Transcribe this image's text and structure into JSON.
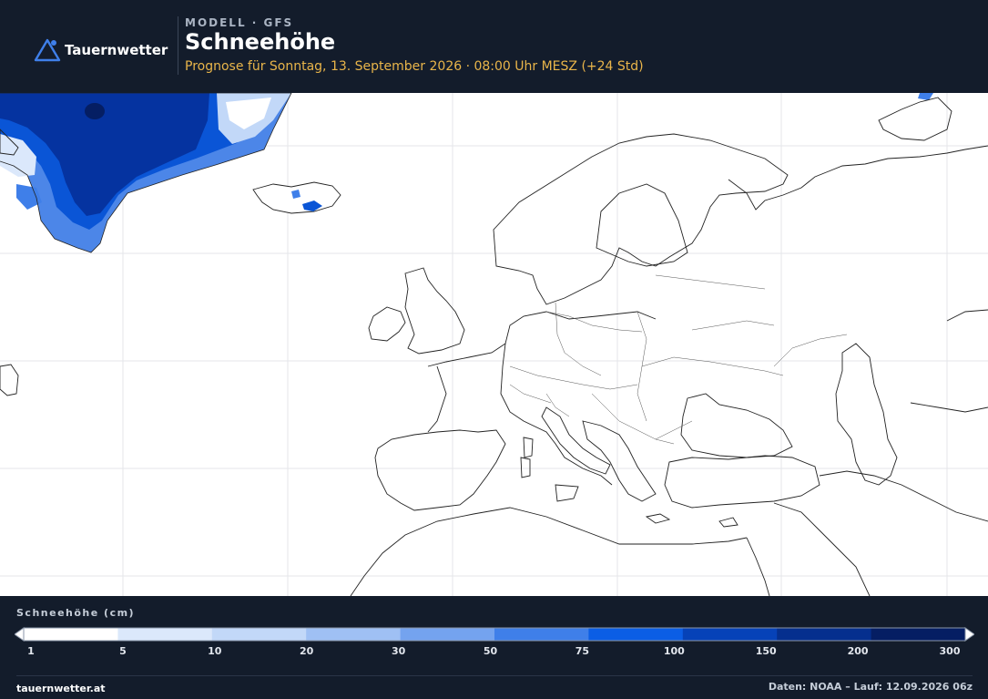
{
  "brand": {
    "name": "Tauernwetter",
    "website": "tauernwetter.at"
  },
  "header": {
    "model": "MODELL · GFS",
    "title": "Schneehöhe",
    "subtitle": "Prognose für Sonntag, 13. September 2026 · 08:00 Uhr MESZ  (+24 Std)"
  },
  "legend": {
    "title": "Schneehöhe (cm)",
    "ticks": [
      "1",
      "5",
      "10",
      "20",
      "30",
      "50",
      "75",
      "100",
      "150",
      "200",
      "300"
    ],
    "colors": [
      "#ffffff",
      "#dbe8fb",
      "#c2d8f8",
      "#9fc0f4",
      "#74a3ef",
      "#3f7fe9",
      "#0b5ee5",
      "#0642b8",
      "#052f8e",
      "#051e63",
      "#030f34"
    ]
  },
  "footer": {
    "source": "Daten: NOAA – Lauf: 12.09.2026 06z"
  },
  "colors": {
    "header_bg": "#131c2b",
    "accent": "#e9b54a",
    "snow_deep": "#0533a0",
    "snow_mid": "#0a55d6",
    "snow_light": "#4c86e8"
  },
  "icons": {
    "logo": "mountain-triangle-icon"
  }
}
